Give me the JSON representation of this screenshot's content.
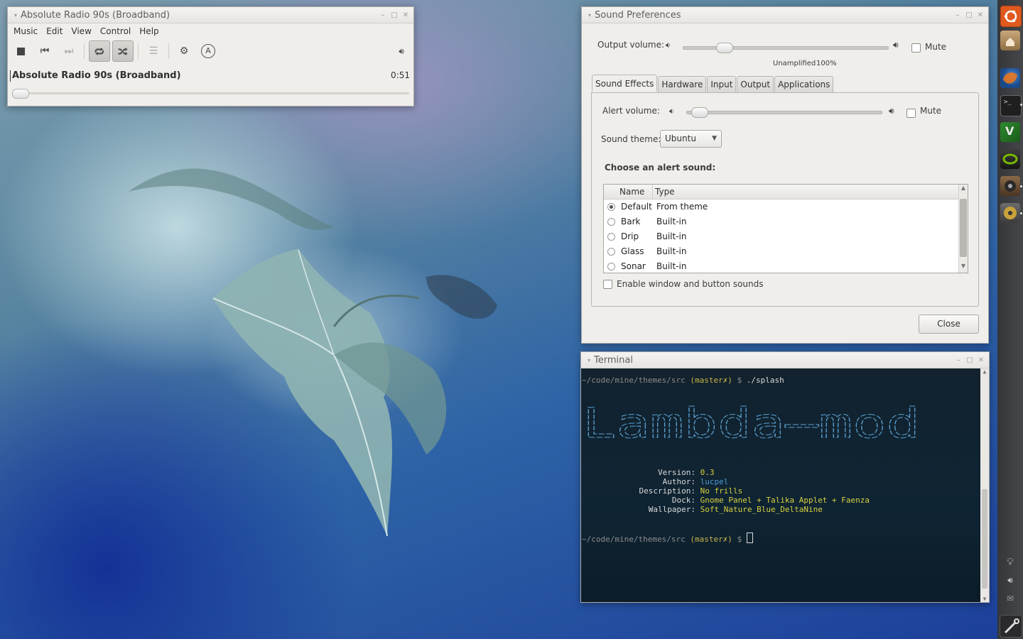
{
  "rhythmbox": {
    "title": "Absolute Radio 90s (Broadband)",
    "menu": [
      "Music",
      "Edit",
      "View",
      "Control",
      "Help"
    ],
    "now_playing": "Absolute Radio 90s (Broadband)",
    "elapsed": "0:51",
    "repeat_active": true,
    "shuffle_active": true,
    "seek_position": 0.0
  },
  "sound_prefs": {
    "title": "Sound Preferences",
    "output_volume_label": "Output volume:",
    "output_volume": 0.15,
    "output_mute_label": "Mute",
    "output_mute_checked": false,
    "unamplified_label": "Unamplified",
    "hundred_label": "100%",
    "tabs": [
      "Sound Effects",
      "Hardware",
      "Input",
      "Output",
      "Applications"
    ],
    "selected_tab": "Sound Effects",
    "alert_volume_label": "Alert volume:",
    "alert_volume": 0.0,
    "alert_mute_label": "Mute",
    "alert_mute_checked": false,
    "sound_theme_label": "Sound theme:",
    "sound_theme": "Ubuntu",
    "choose_alert_label": "Choose an alert sound:",
    "columns": [
      "Name",
      "Type"
    ],
    "sounds": [
      {
        "name": "Default",
        "type": "From theme",
        "selected": true
      },
      {
        "name": "Bark",
        "type": "Built-in",
        "selected": false
      },
      {
        "name": "Drip",
        "type": "Built-in",
        "selected": false
      },
      {
        "name": "Glass",
        "type": "Built-in",
        "selected": false
      },
      {
        "name": "Sonar",
        "type": "Built-in",
        "selected": false
      }
    ],
    "enable_sounds_label": "Enable window and button sounds",
    "enable_sounds_checked": false,
    "close_label": "Close"
  },
  "terminal": {
    "title": "Terminal",
    "prompt_path": "~/code/mine/themes/src",
    "prompt_branch": "(master✗)",
    "prompt_dollar": "$",
    "command": "./splash",
    "banner_text": "Lambda—mod",
    "info": [
      {
        "key": "Version:",
        "value": "0.3",
        "color": "yellow"
      },
      {
        "key": "Author:",
        "value": "lucpel",
        "color": "blue"
      },
      {
        "key": "Description:",
        "value": "No frills",
        "color": "yellow"
      },
      {
        "key": "Dock:",
        "value": "Gnome Panel + Talika Applet + Faenza",
        "color": "yellow"
      },
      {
        "key": "Wallpaper:",
        "value": "Soft_Nature_Blue_DeltaNine",
        "color": "yellow"
      }
    ]
  },
  "dock": {
    "apps": [
      "ubuntu-logo-icon",
      "home-folder-icon",
      "firefox-icon",
      "terminal-icon",
      "vim-icon",
      "nvidia-icon",
      "speaker-icon",
      "rhythmbox-icon"
    ],
    "tray": [
      "lightbulb-icon",
      "volume-icon",
      "mail-icon",
      "settings-icon"
    ]
  },
  "colors": {
    "accent_orange": "#e05a1f",
    "terminal_yellow": "#d6cf3f",
    "terminal_blue": "#4f98d6"
  }
}
